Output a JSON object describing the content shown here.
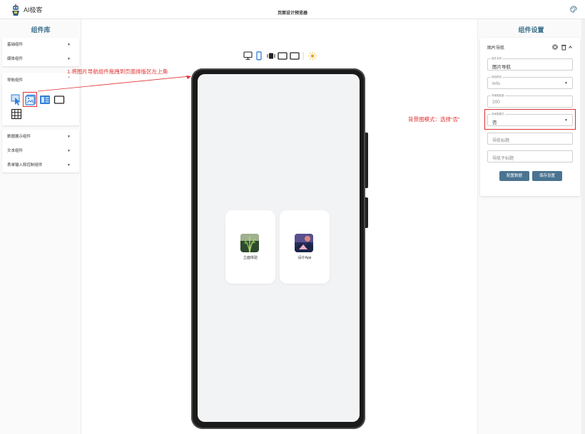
{
  "app": {
    "name": "AI极客",
    "page_title": "页面设计预览器"
  },
  "left": {
    "title": "组件库",
    "groups": [
      {
        "label": "基础组件"
      },
      {
        "label": "媒体组件"
      },
      {
        "label": "导航组件"
      },
      {
        "label": "数据展示组件"
      },
      {
        "label": "文本组件"
      },
      {
        "label": "表单输入和控制组件"
      }
    ]
  },
  "preview": {
    "cards": [
      {
        "label": "立面体验"
      },
      {
        "label": "设计App"
      }
    ]
  },
  "right": {
    "title": "组件设置",
    "card_title": "图片导航",
    "fields": [
      {
        "label": "组件名称",
        "value": "图片导航"
      },
      {
        "label": "按钮颜色",
        "value": "Info"
      },
      {
        "label": "背景图高度",
        "value": "200"
      },
      {
        "label": "背景图模式",
        "value": "否"
      },
      {
        "placeholder": "导航标题"
      },
      {
        "placeholder": "导航子标题"
      }
    ],
    "buttons": {
      "config": "配置数据",
      "save": "保存设置"
    }
  },
  "annotations": {
    "step1": "1.将图片导航组件拖拽到页面排版区左上角",
    "step2": "背景图模式：选择“否”"
  },
  "colors": {
    "accent": "#4a7491",
    "title": "#3d6f8c",
    "annotation": "#e03030",
    "icon_blue": "#2f80d8"
  }
}
